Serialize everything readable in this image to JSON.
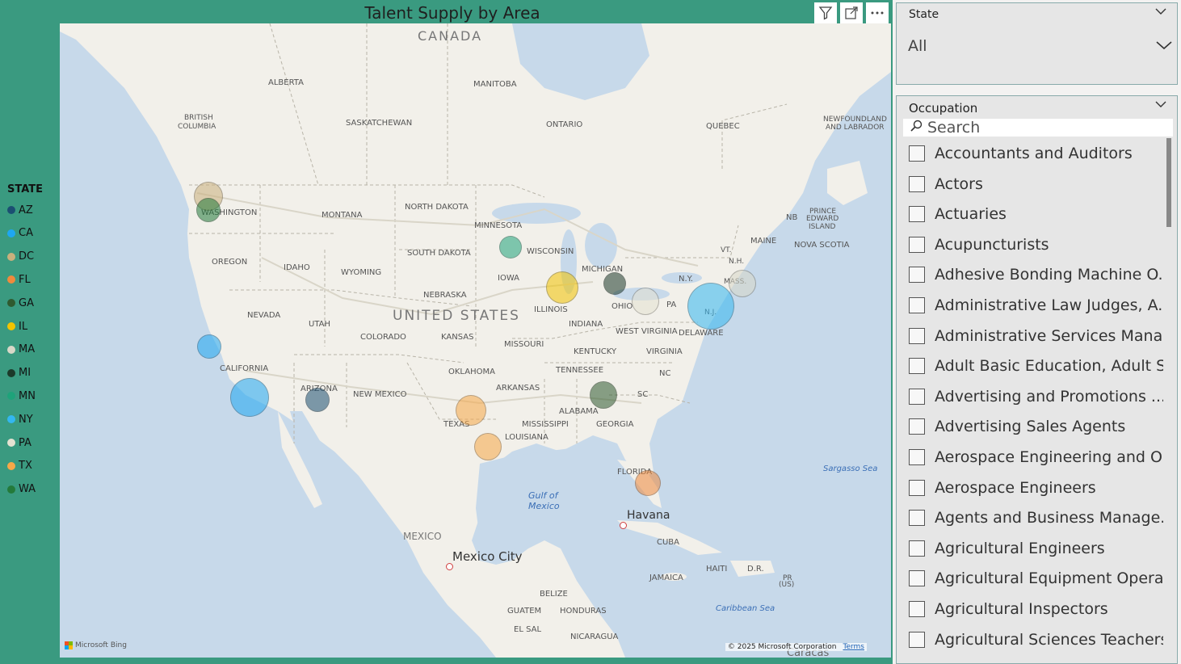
{
  "visual": {
    "title": "Talent Supply by Area",
    "header_icons": [
      "filter-icon",
      "focus-mode-icon",
      "more-options-icon"
    ]
  },
  "legend": {
    "title": "STATE",
    "items": [
      {
        "label": "AZ",
        "color": "#1b4f72"
      },
      {
        "label": "CA",
        "color": "#1ea7f2"
      },
      {
        "label": "DC",
        "color": "#c9b07d"
      },
      {
        "label": "FL",
        "color": "#f08a3c"
      },
      {
        "label": "GA",
        "color": "#2f5a2f"
      },
      {
        "label": "IL",
        "color": "#f2c400"
      },
      {
        "label": "MA",
        "color": "#d8d8c8"
      },
      {
        "label": "MI",
        "color": "#1c3a2a"
      },
      {
        "label": "MN",
        "color": "#1ea37a"
      },
      {
        "label": "NY",
        "color": "#33b7f0"
      },
      {
        "label": "PA",
        "color": "#e5e2d2"
      },
      {
        "label": "TX",
        "color": "#f7a848"
      },
      {
        "label": "WA",
        "color": "#237a3a"
      }
    ]
  },
  "map": {
    "labels": {
      "canada": "CANADA",
      "united_states": "UNITED STATES",
      "mexico": "MEXICO",
      "mexico_city": "Mexico City",
      "havana": "Havana",
      "gulf": "Gulf of",
      "gulf2": "Mexico",
      "sargasso": "Sargasso Sea",
      "caribbean": "Caribbean Sea",
      "caracas": "Caracas",
      "alberta": "ALBERTA",
      "manitoba": "MANITOBA",
      "bc1": "BRITISH",
      "bc2": "COLUMBIA",
      "saskatchewan": "SASKATCHEWAN",
      "ontario": "ONTARIO",
      "quebec": "QUEBEC",
      "nfl1": "NEWFOUNDLAND",
      "nfl2": "AND LABRADOR",
      "washington": "WASHINGTON",
      "montana": "MONTANA",
      "north_dakota": "NORTH DAKOTA",
      "minnesota": "MINNESOTA",
      "oregon": "OREGON",
      "idaho": "IDAHO",
      "wyoming": "WYOMING",
      "south_dakota": "SOUTH DAKOTA",
      "wisconsin": "WISCONSIN",
      "michigan": "MICHIGAN",
      "iowa": "IOWA",
      "nebraska": "NEBRASKA",
      "nevada": "NEVADA",
      "utah": "UTAH",
      "colorado": "COLORADO",
      "kansas": "KANSAS",
      "missouri": "MISSOURI",
      "illinois": "ILLINOIS",
      "indiana": "INDIANA",
      "ohio": "OHIO",
      "pa": "PA",
      "ny": "N.Y.",
      "california": "CALIFORNIA",
      "arizona": "ARIZONA",
      "new_mexico": "NEW MEXICO",
      "oklahoma": "OKLAHOMA",
      "arkansas": "ARKANSAS",
      "tennessee": "TENNESSEE",
      "kentucky": "KENTUCKY",
      "west_virginia": "WEST VIRGINIA",
      "virginia": "VIRGINIA",
      "delaware": "DELAWARE",
      "nc": "NC",
      "sc": "SC",
      "texas": "TEXAS",
      "louisiana": "LOUISIANA",
      "mississippi": "MISSISSIPPI",
      "alabama": "ALABAMA",
      "georgia": "GEORGIA",
      "florida": "FLORIDA",
      "maine": "MAINE",
      "nb": "NB",
      "pei1": "PRINCE",
      "pei2": "EDWARD",
      "pei3": "ISLAND",
      "nova_scotia": "NOVA SCOTIA",
      "vt": "VT.",
      "nh": "N.H.",
      "mass": "MASS.",
      "nj": "N.J.",
      "cuba": "CUBA",
      "haiti": "HAITI",
      "dr": "D.R.",
      "pr1": "PR",
      "pr2": "(US)",
      "jamaica": "JAMAICA",
      "belize": "BELIZE",
      "guatemala": "GUATEM",
      "honduras": "HONDURAS",
      "el_salvador": "EL SAL",
      "nicaragua": "NICARAGUA"
    },
    "bubbles": [
      {
        "state": "DC",
        "color": "#c9b07d",
        "size": "medium"
      },
      {
        "state": "WA",
        "color": "#237a3a",
        "size": "small"
      },
      {
        "state": "MN",
        "color": "#1ea37a",
        "size": "small"
      },
      {
        "state": "IL",
        "color": "#f2c400",
        "size": "medium"
      },
      {
        "state": "MI",
        "color": "#1c3a2a",
        "size": "small"
      },
      {
        "state": "PA",
        "color": "#e5e2d2",
        "size": "medium"
      },
      {
        "state": "MA",
        "color": "#d8d8c8",
        "size": "small"
      },
      {
        "state": "NY",
        "color": "#33b7f0",
        "size": "large"
      },
      {
        "state": "CA",
        "color": "#1ea7f2",
        "size": "small"
      },
      {
        "state": "CA",
        "color": "#1ea7f2",
        "size": "large"
      },
      {
        "state": "AZ",
        "color": "#1b4f72",
        "size": "small"
      },
      {
        "state": "TX",
        "color": "#f7a848",
        "size": "medium"
      },
      {
        "state": "TX",
        "color": "#f7a848",
        "size": "medium"
      },
      {
        "state": "GA",
        "color": "#2f5a2f",
        "size": "small"
      },
      {
        "state": "FL",
        "color": "#f08a3c",
        "size": "small"
      }
    ],
    "attribution": "Microsoft Bing",
    "copyright": "© 2025 Microsoft Corporation",
    "terms": "Terms"
  },
  "state_slicer": {
    "title": "State",
    "selected": "All"
  },
  "occupation_slicer": {
    "title": "Occupation",
    "search_placeholder": "Search",
    "items": [
      "Accountants and Auditors",
      "Actors",
      "Actuaries",
      "Acupuncturists",
      "Adhesive Bonding Machine O...",
      "Administrative Law Judges, A...",
      "Administrative Services Mana...",
      "Adult Basic Education, Adult S...",
      "Advertising and Promotions ...",
      "Advertising Sales Agents",
      "Aerospace Engineering and O...",
      "Aerospace Engineers",
      "Agents and Business Manage...",
      "Agricultural Engineers",
      "Agricultural Equipment Opera...",
      "Agricultural Inspectors",
      "Agricultural Sciences Teachers..."
    ]
  }
}
